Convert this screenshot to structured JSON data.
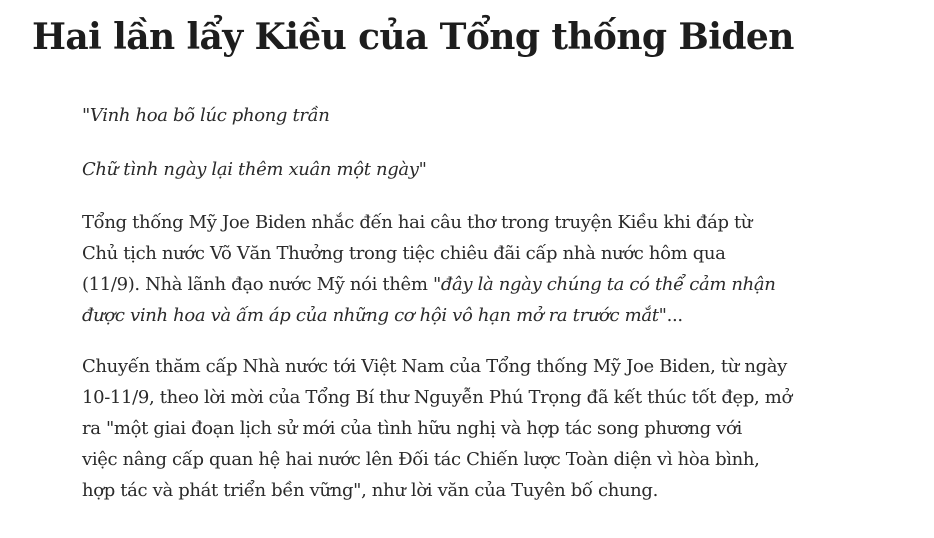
{
  "article": {
    "title": "Hai lần lẩy Kiều của Tổng thống Biden",
    "verse": [
      "\"Vinh hoa bõ lúc phong trần",
      "Chữ tình ngày lại thêm xuân một ngày\""
    ],
    "paragraph_1": {
      "line_1": "Tổng thống Mỹ Joe Biden nhắc đến hai câu thơ trong truyện Kiều khi đáp từ",
      "line_2": "Chủ tịch nước Võ Văn Thưởng trong tiệc chiêu đãi cấp nhà nước hôm qua",
      "line_3_plain": "(11/9). Nhà lãnh đạo nước Mỹ nói thêm ",
      "line_3_quote": "\"đây là ngày chúng ta có thể cảm nhận",
      "line_4_quote": "được vinh hoa và ấm áp của những cơ hội vô hạn mở ra trước mắt\"",
      "line_4_tail": "..."
    },
    "paragraph_2": [
      "Chuyến thăm cấp Nhà nước tới Việt Nam của Tổng thống Mỹ Joe Biden, từ ngày",
      "10-11/9, theo lời mời của Tổng Bí thư Nguyễn Phú Trọng đã kết thúc tốt đẹp, mở",
      "ra \"một giai đoạn lịch sử mới của tình hữu nghị và hợp tác song phương với",
      "việc nâng cấp quan hệ hai nước lên Đối tác Chiến lược Toàn diện vì hòa bình,",
      "hợp tác và phát triển bền vững\", như lời văn của Tuyên bố chung."
    ]
  }
}
